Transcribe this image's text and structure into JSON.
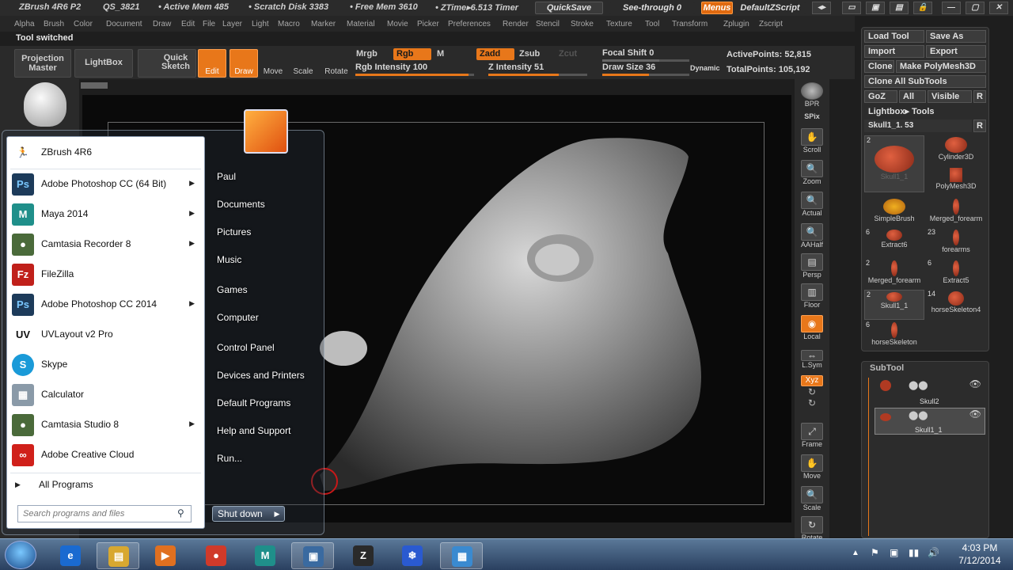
{
  "titlebar": {
    "app": "ZBrush 4R6 P2",
    "qs": "QS_3821",
    "active_mem": "• Active Mem 485",
    "scratch": "• Scratch Disk 3383",
    "free_mem": "• Free Mem 3610",
    "ztime": "• ZTime▸6.513 Timer",
    "quicksave": "QuickSave",
    "see_through": "See-through   0",
    "menus": "Menus",
    "script": "DefaultZScript"
  },
  "menubar": [
    "Alpha",
    "Brush",
    "Color",
    "Document",
    "Draw",
    "Edit",
    "File",
    "Layer",
    "Light",
    "Macro",
    "Marker",
    "Material",
    "Movie",
    "Picker",
    "Preferences",
    "Render",
    "Stencil",
    "Stroke",
    "Texture",
    "Tool",
    "Transform",
    "Zplugin",
    "Zscript"
  ],
  "status": "Tool switched",
  "toolbar": {
    "projection_master": "Projection Master",
    "lightbox": "LightBox",
    "quick_sketch": "Quick Sketch",
    "edit": "Edit",
    "draw": "Draw",
    "move": "Move",
    "scale": "Scale",
    "rotate": "Rotate",
    "mrgb": "Mrgb",
    "rgb": "Rgb",
    "m": "M",
    "rgb_intensity": "Rgb  Intensity 100",
    "zadd": "Zadd",
    "zsub": "Zsub",
    "zcut": "Zcut",
    "z_intensity": "Z  Intensity 51",
    "focal_shift": "Focal Shift 0",
    "draw_size": "Draw Size 36",
    "dynamic": "Dynamic",
    "active_points": "ActivePoints: 52,815",
    "total_points": "TotalPoints: 105,192",
    "rgb_intensity_value": 100,
    "z_intensity_value": 51,
    "draw_size_value": 36
  },
  "rightbar": [
    "BPR",
    "SPix",
    "Scroll",
    "Zoom",
    "Actual",
    "AAHalf",
    "Persp",
    "Floor",
    "Local",
    "L.Sym",
    "Xyz",
    "Frame",
    "Move",
    "Scale",
    "Rotate"
  ],
  "toolpanel": {
    "load_tool": "Load Tool",
    "save_as": "Save As",
    "import": "Import",
    "export": "Export",
    "clone": "Clone",
    "make_polymesh": "Make PolyMesh3D",
    "clone_all": "Clone  All SubTools",
    "goz": "GoZ",
    "all": "All",
    "visible": "Visible",
    "r": "R",
    "lightbox_tools": "Lightbox▸ Tools",
    "current": "Skull1_1. 53",
    "items": [
      {
        "label": "Skull1_1",
        "count": "2"
      },
      {
        "label": "Cylinder3D",
        "count": ""
      },
      {
        "label": "PolyMesh3D",
        "count": ""
      },
      {
        "label": "SimpleBrush",
        "count": ""
      },
      {
        "label": "Merged_forearm",
        "count": ""
      },
      {
        "label": "Extract6",
        "count": "6"
      },
      {
        "label": "forearms",
        "count": "23"
      },
      {
        "label": "Merged_forearm",
        "count": "2"
      },
      {
        "label": "Extract5",
        "count": "6"
      },
      {
        "label": "Skull1_1",
        "count": "2"
      },
      {
        "label": "horseSkeleton4",
        "count": "14"
      },
      {
        "label": "horseSkeleton",
        "count": "6"
      }
    ]
  },
  "subtool": {
    "title": "SubTool",
    "rows": [
      "Skull2",
      "Skull1_1"
    ]
  },
  "startmenu": {
    "programs": [
      {
        "name": "ZBrush 4R6",
        "icon": "zbrush-icon",
        "arrow": false,
        "color": "#ffffff"
      },
      {
        "name": "Adobe Photoshop CC (64 Bit)",
        "icon": "photoshop-icon",
        "arrow": true,
        "color": "#1d3b5a"
      },
      {
        "name": "Maya 2014",
        "icon": "maya-icon",
        "arrow": true,
        "color": "#1f8f8a"
      },
      {
        "name": "Camtasia Recorder 8",
        "icon": "camtasia-recorder-icon",
        "arrow": true,
        "color": "#4a6a3a"
      },
      {
        "name": "FileZilla",
        "icon": "filezilla-icon",
        "arrow": false,
        "color": "#c0201a"
      },
      {
        "name": "Adobe Photoshop CC 2014",
        "icon": "photoshop-icon",
        "arrow": true,
        "color": "#1d3b5a"
      },
      {
        "name": "UVLayout v2 Pro",
        "icon": "uvlayout-icon",
        "arrow": false,
        "color": "#ffffff"
      },
      {
        "name": "Skype",
        "icon": "skype-icon",
        "arrow": false,
        "color": "#1a9ad8"
      },
      {
        "name": "Calculator",
        "icon": "calculator-icon",
        "arrow": false,
        "color": "#8a9aa8"
      },
      {
        "name": "Camtasia Studio 8",
        "icon": "camtasia-studio-icon",
        "arrow": true,
        "color": "#4a6a3a"
      },
      {
        "name": "Adobe Creative Cloud",
        "icon": "creative-cloud-icon",
        "arrow": false,
        "color": "#d0201a"
      }
    ],
    "all_programs": "All Programs",
    "search_placeholder": "Search programs and files",
    "places": [
      "Paul",
      "Documents",
      "Pictures",
      "Music",
      "Games",
      "Computer",
      "Control Panel",
      "Devices and Printers",
      "Default Programs",
      "Help and Support",
      "Run..."
    ],
    "shutdown": "Shut down"
  },
  "taskbar": {
    "apps": [
      {
        "name": "internet-explorer-icon",
        "color": "#1a6ad0",
        "glyph": "e",
        "open": false
      },
      {
        "name": "file-explorer-icon",
        "color": "#d8a830",
        "glyph": "▤",
        "open": true
      },
      {
        "name": "media-player-icon",
        "color": "#e07020",
        "glyph": "▶",
        "open": false
      },
      {
        "name": "chrome-icon",
        "color": "#d03a2a",
        "glyph": "●",
        "open": false
      },
      {
        "name": "maya-icon",
        "color": "#1f8f8a",
        "glyph": "M",
        "open": false
      },
      {
        "name": "photo-viewer-icon",
        "color": "#3a6aa0",
        "glyph": "▣",
        "open": true
      },
      {
        "name": "zbrush-icon",
        "color": "#2a2a2a",
        "glyph": "Z",
        "open": false
      },
      {
        "name": "snowflake-app-icon",
        "color": "#2a5ad0",
        "glyph": "❄",
        "open": false
      },
      {
        "name": "remote-desktop-icon",
        "color": "#3a8ad0",
        "glyph": "▦",
        "open": true
      }
    ],
    "time": "4:03 PM",
    "date": "7/12/2014"
  }
}
